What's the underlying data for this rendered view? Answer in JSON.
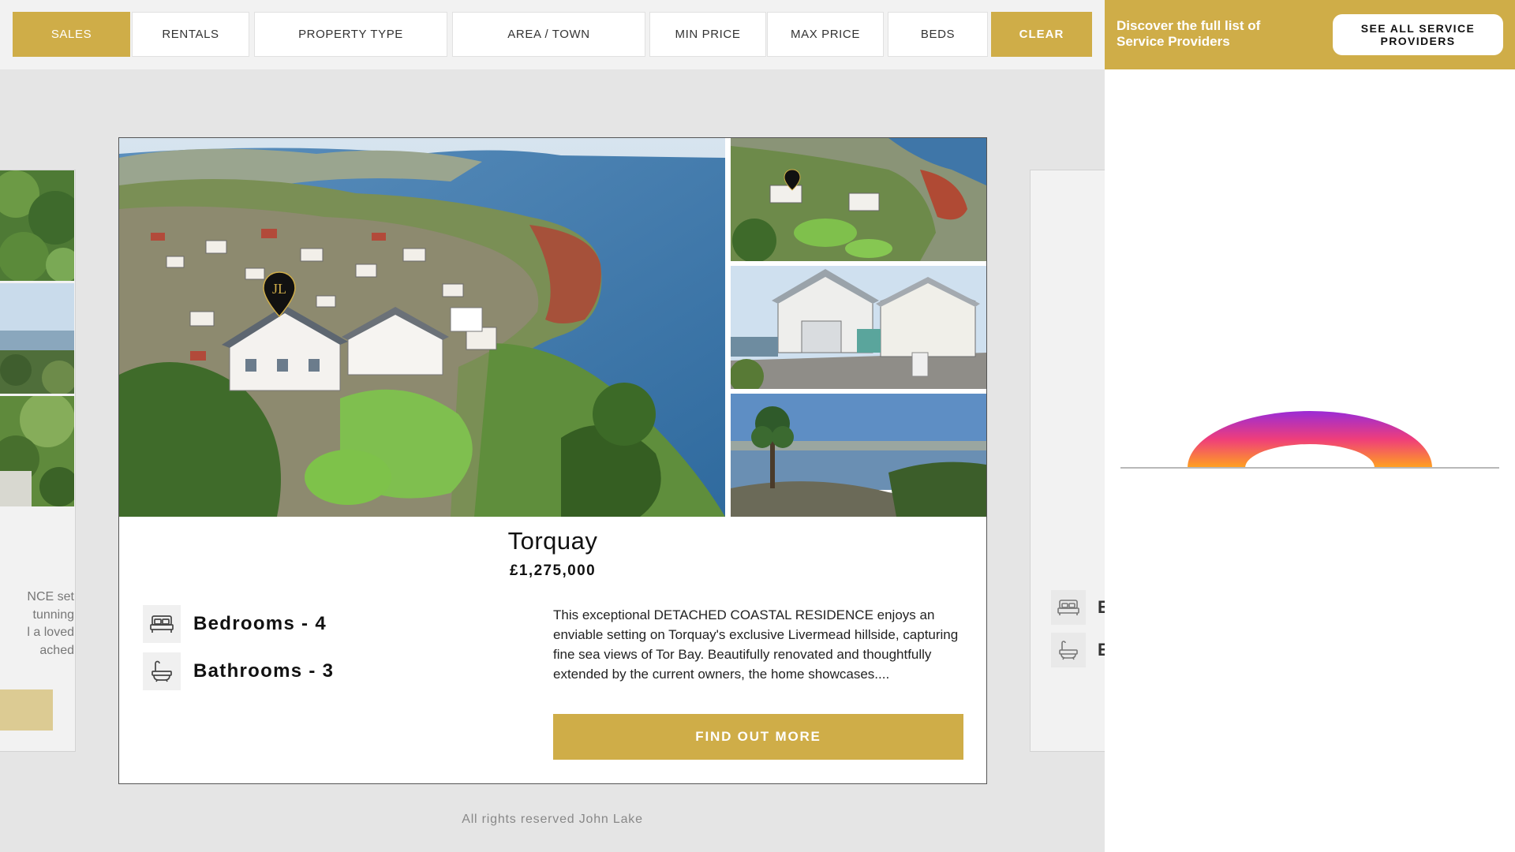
{
  "filters": {
    "sales": "SALES",
    "rentals": "RENTALS",
    "property_type": "PROPERTY TYPE",
    "area_town": "AREA / TOWN",
    "min_price": "MIN PRICE",
    "max_price": "MAX PRICE",
    "beds": "BEDS",
    "clear": "CLEAR",
    "active": "sales"
  },
  "sidebar": {
    "discover_text": "Discover the full list of Service Providers",
    "see_all_label": "SEE ALL SERVICE PROVIDERS"
  },
  "left_peek": {
    "text_lines": [
      "NCE set",
      "tunning",
      "l a loved",
      "ached"
    ]
  },
  "right_peek": {
    "bed_letter": "E",
    "bath_letter": "E"
  },
  "listing": {
    "town": "Torquay",
    "price": "£1,275,000",
    "bedrooms": "Bedrooms - 4",
    "bathrooms": "Bathrooms - 3",
    "description": "This exceptional DETACHED COASTAL RESIDENCE enjoys an enviable setting on Torquay's exclusive Livermead hillside, capturing fine sea views of Tor Bay. Beautifully renovated and thoughtfully extended by the current owners, the home showcases....",
    "cta_label": "FIND OUT MORE",
    "pin_logo": "JL"
  },
  "footer": {
    "text": "All rights reserved John Lake"
  },
  "colors": {
    "gold": "#cfad48",
    "loader_start": "#9b2bd6",
    "loader_mid": "#ef3e7a",
    "loader_end": "#ffa21f"
  },
  "icons": {
    "bed": "bed-icon",
    "bath": "bath-icon",
    "pin": "map-pin-icon"
  }
}
